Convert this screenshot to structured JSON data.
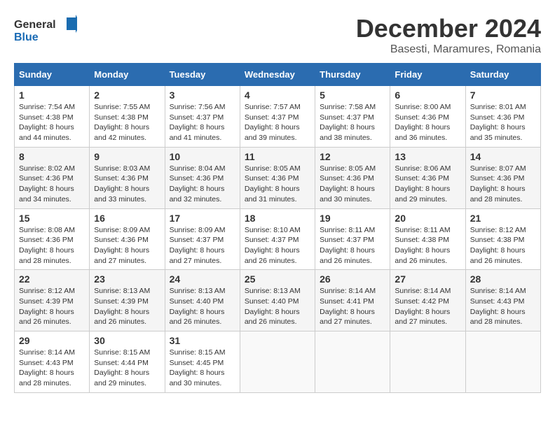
{
  "logo": {
    "general": "General",
    "blue": "Blue"
  },
  "title": {
    "month": "December 2024",
    "location": "Basesti, Maramures, Romania"
  },
  "weekdays": [
    "Sunday",
    "Monday",
    "Tuesday",
    "Wednesday",
    "Thursday",
    "Friday",
    "Saturday"
  ],
  "weeks": [
    [
      {
        "day": "1",
        "sunrise": "7:54 AM",
        "sunset": "4:38 PM",
        "daylight": "8 hours and 44 minutes."
      },
      {
        "day": "2",
        "sunrise": "7:55 AM",
        "sunset": "4:38 PM",
        "daylight": "8 hours and 42 minutes."
      },
      {
        "day": "3",
        "sunrise": "7:56 AM",
        "sunset": "4:37 PM",
        "daylight": "8 hours and 41 minutes."
      },
      {
        "day": "4",
        "sunrise": "7:57 AM",
        "sunset": "4:37 PM",
        "daylight": "8 hours and 39 minutes."
      },
      {
        "day": "5",
        "sunrise": "7:58 AM",
        "sunset": "4:37 PM",
        "daylight": "8 hours and 38 minutes."
      },
      {
        "day": "6",
        "sunrise": "8:00 AM",
        "sunset": "4:36 PM",
        "daylight": "8 hours and 36 minutes."
      },
      {
        "day": "7",
        "sunrise": "8:01 AM",
        "sunset": "4:36 PM",
        "daylight": "8 hours and 35 minutes."
      }
    ],
    [
      {
        "day": "8",
        "sunrise": "8:02 AM",
        "sunset": "4:36 PM",
        "daylight": "8 hours and 34 minutes."
      },
      {
        "day": "9",
        "sunrise": "8:03 AM",
        "sunset": "4:36 PM",
        "daylight": "8 hours and 33 minutes."
      },
      {
        "day": "10",
        "sunrise": "8:04 AM",
        "sunset": "4:36 PM",
        "daylight": "8 hours and 32 minutes."
      },
      {
        "day": "11",
        "sunrise": "8:05 AM",
        "sunset": "4:36 PM",
        "daylight": "8 hours and 31 minutes."
      },
      {
        "day": "12",
        "sunrise": "8:05 AM",
        "sunset": "4:36 PM",
        "daylight": "8 hours and 30 minutes."
      },
      {
        "day": "13",
        "sunrise": "8:06 AM",
        "sunset": "4:36 PM",
        "daylight": "8 hours and 29 minutes."
      },
      {
        "day": "14",
        "sunrise": "8:07 AM",
        "sunset": "4:36 PM",
        "daylight": "8 hours and 28 minutes."
      }
    ],
    [
      {
        "day": "15",
        "sunrise": "8:08 AM",
        "sunset": "4:36 PM",
        "daylight": "8 hours and 28 minutes."
      },
      {
        "day": "16",
        "sunrise": "8:09 AM",
        "sunset": "4:36 PM",
        "daylight": "8 hours and 27 minutes."
      },
      {
        "day": "17",
        "sunrise": "8:09 AM",
        "sunset": "4:37 PM",
        "daylight": "8 hours and 27 minutes."
      },
      {
        "day": "18",
        "sunrise": "8:10 AM",
        "sunset": "4:37 PM",
        "daylight": "8 hours and 26 minutes."
      },
      {
        "day": "19",
        "sunrise": "8:11 AM",
        "sunset": "4:37 PM",
        "daylight": "8 hours and 26 minutes."
      },
      {
        "day": "20",
        "sunrise": "8:11 AM",
        "sunset": "4:38 PM",
        "daylight": "8 hours and 26 minutes."
      },
      {
        "day": "21",
        "sunrise": "8:12 AM",
        "sunset": "4:38 PM",
        "daylight": "8 hours and 26 minutes."
      }
    ],
    [
      {
        "day": "22",
        "sunrise": "8:12 AM",
        "sunset": "4:39 PM",
        "daylight": "8 hours and 26 minutes."
      },
      {
        "day": "23",
        "sunrise": "8:13 AM",
        "sunset": "4:39 PM",
        "daylight": "8 hours and 26 minutes."
      },
      {
        "day": "24",
        "sunrise": "8:13 AM",
        "sunset": "4:40 PM",
        "daylight": "8 hours and 26 minutes."
      },
      {
        "day": "25",
        "sunrise": "8:13 AM",
        "sunset": "4:40 PM",
        "daylight": "8 hours and 26 minutes."
      },
      {
        "day": "26",
        "sunrise": "8:14 AM",
        "sunset": "4:41 PM",
        "daylight": "8 hours and 27 minutes."
      },
      {
        "day": "27",
        "sunrise": "8:14 AM",
        "sunset": "4:42 PM",
        "daylight": "8 hours and 27 minutes."
      },
      {
        "day": "28",
        "sunrise": "8:14 AM",
        "sunset": "4:43 PM",
        "daylight": "8 hours and 28 minutes."
      }
    ],
    [
      {
        "day": "29",
        "sunrise": "8:14 AM",
        "sunset": "4:43 PM",
        "daylight": "8 hours and 28 minutes."
      },
      {
        "day": "30",
        "sunrise": "8:15 AM",
        "sunset": "4:44 PM",
        "daylight": "8 hours and 29 minutes."
      },
      {
        "day": "31",
        "sunrise": "8:15 AM",
        "sunset": "4:45 PM",
        "daylight": "8 hours and 30 minutes."
      },
      null,
      null,
      null,
      null
    ]
  ],
  "labels": {
    "sunrise": "Sunrise:",
    "sunset": "Sunset:",
    "daylight": "Daylight:"
  }
}
